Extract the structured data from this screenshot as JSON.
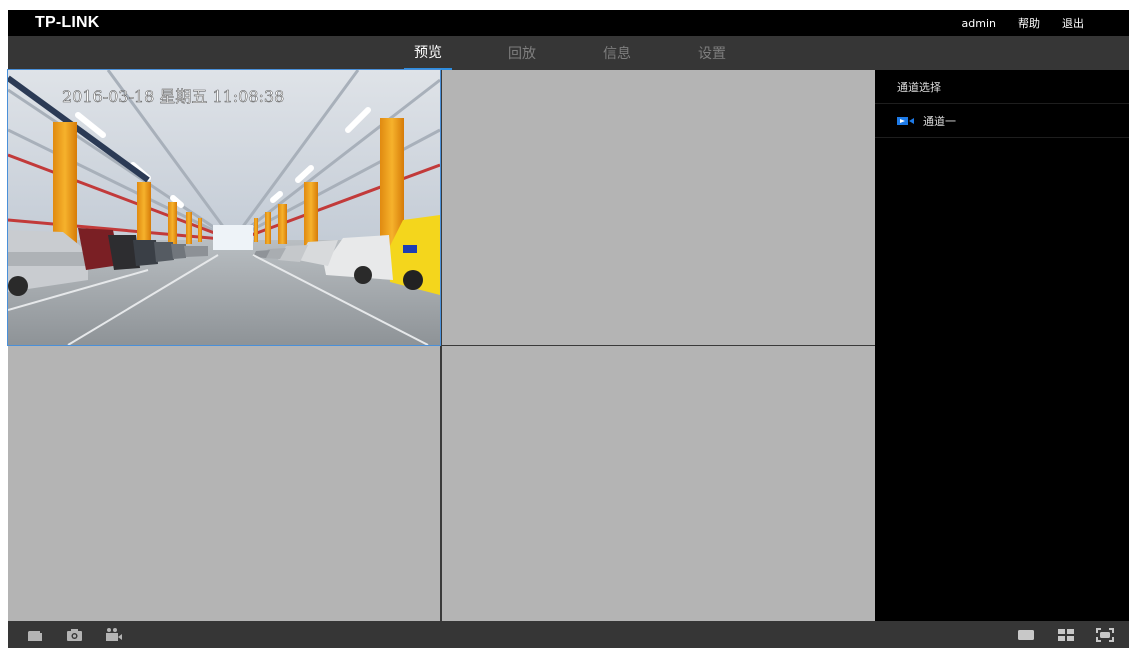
{
  "header": {
    "logo": "TP-LINK",
    "user": "admin",
    "help": "帮助",
    "logout": "退出"
  },
  "nav": {
    "tabs": [
      {
        "label": "预览",
        "active": true
      },
      {
        "label": "回放",
        "active": false
      },
      {
        "label": "信息",
        "active": false
      },
      {
        "label": "设置",
        "active": false
      }
    ]
  },
  "video": {
    "channel1_osd": "2016-03-18 星期五 11:08:38",
    "panes": 4
  },
  "sidebar": {
    "title": "通道选择",
    "channels": [
      {
        "label": "通道一",
        "icon": "camera-icon"
      }
    ]
  },
  "toolbar": {
    "left_icons": [
      "folder-icon",
      "snapshot-icon",
      "record-icon"
    ],
    "right_icons": [
      "single-view-icon",
      "quad-view-icon",
      "fullscreen-icon"
    ]
  },
  "colors": {
    "accent": "#2f8ee0",
    "topbar": "#000000",
    "navbar": "#363636",
    "empty_pane": "#b4b4b4",
    "channel_icon": "#1e7be8"
  }
}
